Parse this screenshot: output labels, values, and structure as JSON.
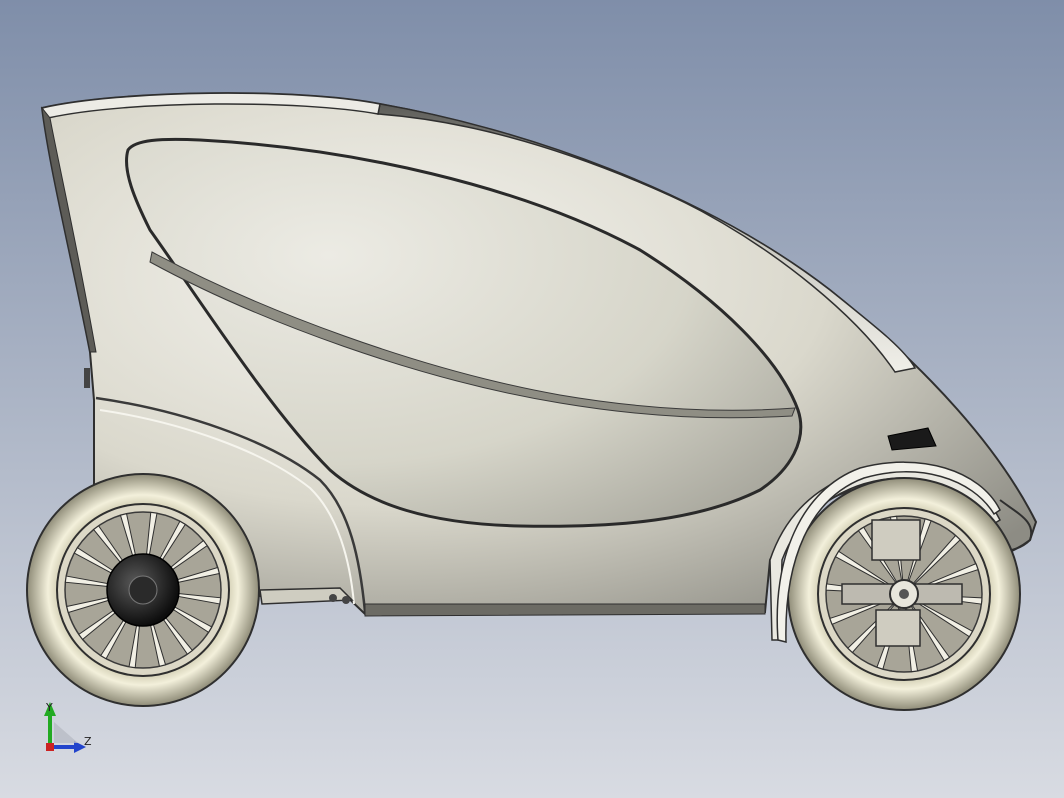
{
  "viewport": {
    "background_top": "#7f8ea9",
    "background_bottom": "#d8dbe2"
  },
  "model": {
    "body_color": "#dedcd0",
    "outline_color": "#2f2f2f",
    "tire_color": "#efecd6",
    "hub_color": "#1c1c1c"
  },
  "triad": {
    "y_label": "Y",
    "z_label": "Z",
    "y_color": "#22aa22",
    "z_color": "#2244cc",
    "x_color": "#cc2222"
  }
}
